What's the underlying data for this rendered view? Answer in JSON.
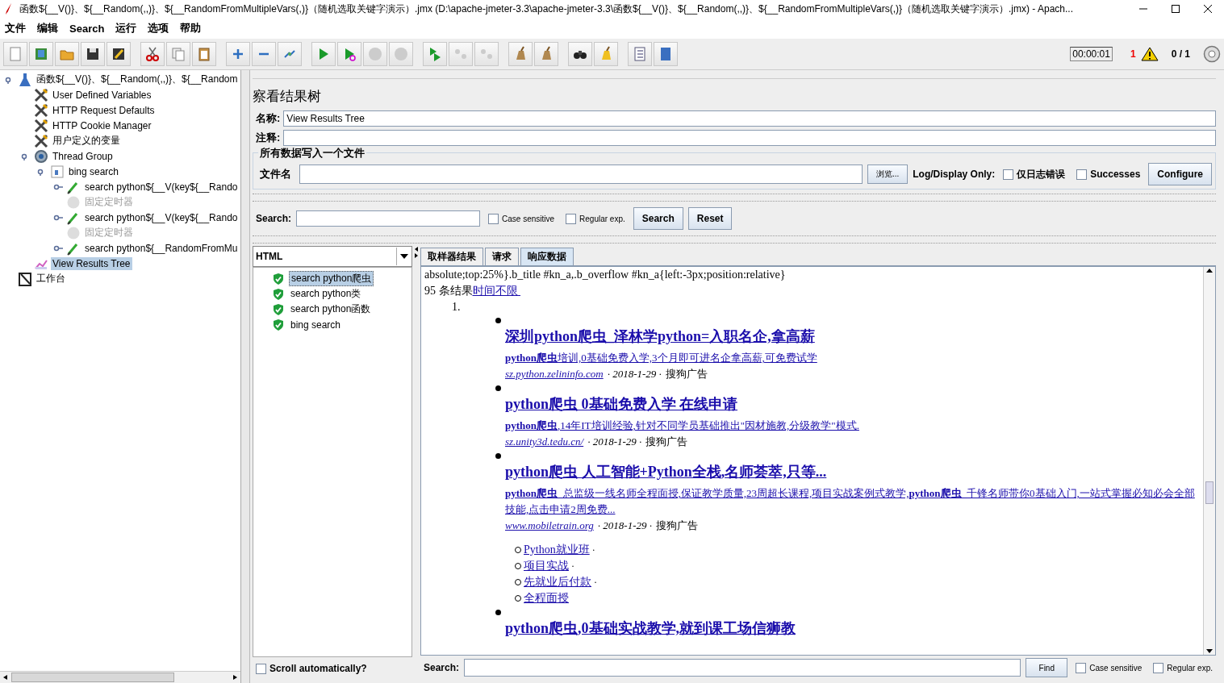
{
  "window": {
    "title": "函数${__V()}、${__Random(,,)}、${__RandomFromMultipleVars(,)}（随机选取关键字演示）.jmx (D:\\apache-jmeter-3.3\\apache-jmeter-3.3\\函数${__V()}、${__Random(,,)}、${__RandomFromMultipleVars(,)}（随机选取关键字演示）.jmx) - Apach..."
  },
  "menu": [
    "文件",
    "编辑",
    "Search",
    "运行",
    "选项",
    "帮助"
  ],
  "status": {
    "timer": "00:00:01",
    "warnings": "1",
    "threads": "0 / 1"
  },
  "tree": [
    {
      "label": "函数${__V()}、${__Random(,,)}、${__Random",
      "kind": "test-plan",
      "expanded": true,
      "selected": false,
      "disabled": false,
      "children": [
        {
          "label": "User Defined Variables",
          "kind": "config",
          "selected": false,
          "disabled": false
        },
        {
          "label": "HTTP Request Defaults",
          "kind": "config",
          "selected": false,
          "disabled": false
        },
        {
          "label": "HTTP Cookie Manager",
          "kind": "config",
          "selected": false,
          "disabled": false
        },
        {
          "label": "用户定义的变量",
          "kind": "config",
          "selected": false,
          "disabled": false
        },
        {
          "label": "Thread Group",
          "kind": "thread-group",
          "expanded": true,
          "selected": false,
          "disabled": false,
          "children": [
            {
              "label": "bing search",
              "kind": "controller",
              "expanded": true,
              "selected": false,
              "disabled": false,
              "children": [
                {
                  "label": "search python${__V(key${__Rando",
                  "kind": "sampler",
                  "expanded": false,
                  "selected": false,
                  "disabled": false
                },
                {
                  "label": "固定定时器",
                  "kind": "timer",
                  "selected": false,
                  "disabled": true
                },
                {
                  "label": "search python${__V(key${__Rando",
                  "kind": "sampler",
                  "expanded": false,
                  "selected": false,
                  "disabled": false
                },
                {
                  "label": "固定定时器",
                  "kind": "timer",
                  "selected": false,
                  "disabled": true
                },
                {
                  "label": "search python${__RandomFromMu",
                  "kind": "sampler",
                  "expanded": false,
                  "selected": false,
                  "disabled": false
                }
              ]
            }
          ]
        },
        {
          "label": "View Results Tree",
          "kind": "listener",
          "selected": true,
          "disabled": false
        }
      ]
    },
    {
      "label": "工作台",
      "kind": "workbench",
      "selected": false,
      "disabled": false
    }
  ],
  "panel": {
    "title": "察看结果树",
    "name_label": "名称:",
    "name_value": "View Results Tree",
    "comment_label": "注释:",
    "file_section": "所有数据写入一个文件",
    "file_label": "文件名",
    "browse": "浏览...",
    "log_display": "Log/Display Only:",
    "log_options": [
      {
        "label": "仅日志错误",
        "checked": false
      },
      {
        "label": "Successes",
        "checked": false
      }
    ],
    "configure": "Configure"
  },
  "search": {
    "label": "Search:",
    "options": [
      {
        "label": "Case sensitive",
        "checked": false
      },
      {
        "label": "Regular exp.",
        "checked": false
      }
    ],
    "search_button": "Search",
    "reset_button": "Reset"
  },
  "renderer": "HTML",
  "samples": [
    {
      "label": "search python爬虫",
      "selected": true
    },
    {
      "label": "search python类",
      "selected": false
    },
    {
      "label": "search python函数",
      "selected": false
    },
    {
      "label": "bing search",
      "selected": false
    }
  ],
  "scroll_auto": {
    "label": "Scroll automatically?",
    "checked": false
  },
  "tabs": [
    {
      "label": "取样器结果",
      "selected": false
    },
    {
      "label": "请求",
      "selected": false
    },
    {
      "label": "响应数据",
      "selected": true
    }
  ],
  "response": {
    "css_line": "absolute;top:25%}.b_title #kn_a,.b_overflow #kn_a{left:-3px;position:relative}",
    "count": "95 条结果",
    "count_link": "时间不限 ",
    "ordinal": "1.",
    "results": [
      {
        "title": "深圳python爬虫_泽林学python=入职名企,拿高薪",
        "desc": "**python爬虫**培训,0基础免费入学,3个月即可进名企拿高薪,可免费试学",
        "url": "sz.python.zelininfo.com",
        "date": "· 2018-1-29 ·",
        "ad": "搜狗广告"
      },
      {
        "title": "python爬虫 0基础免费入学 在线申请",
        "desc": "**python爬虫**,14年IT培训经验,针对不同学员基础推出\"因材施教,分级教学\"模式.",
        "url": "sz.unity3d.tedu.cn/",
        "date": "· 2018-1-29 ·",
        "ad": "搜狗广告"
      },
      {
        "title": "python爬虫 人工智能+Python全栈,名师荟萃,只等...",
        "desc": "**python爬虫**_总监级一线名师全程面授,保证教学质量,23周超长课程,项目实战案例式教学,**python爬虫**_千锋名师带你0基础入门,一站式掌握必知必会全部技能,点击申请2周免费...",
        "url": "www.mobiletrain.org",
        "date": "· 2018-1-29 ·",
        "ad": "搜狗广告",
        "sublinks": [
          {
            "label": "Python就业班",
            "suffix": "·"
          },
          {
            "label": "项目实战",
            "suffix": "·"
          },
          {
            "label": "先就业后付款",
            "suffix": "·"
          },
          {
            "label": "全程面授"
          }
        ]
      },
      {
        "title": "python爬虫,0基础实战教学,就到课工场信狮教"
      }
    ]
  },
  "find": {
    "label": "Search:",
    "button": "Find",
    "options": [
      {
        "label": "Case sensitive",
        "checked": false
      },
      {
        "label": "Regular exp.",
        "checked": false
      }
    ]
  }
}
